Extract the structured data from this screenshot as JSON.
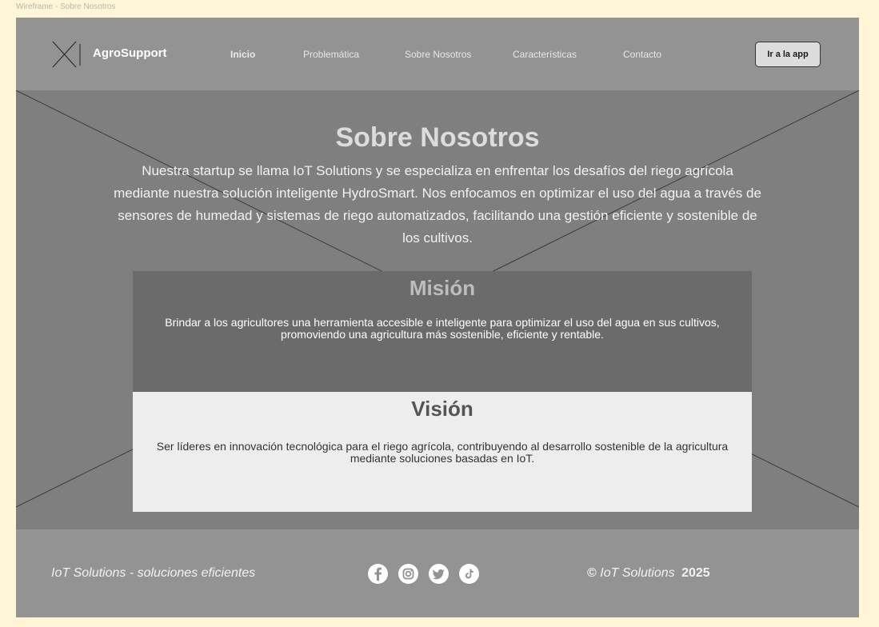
{
  "frame_label": "Wireframe - Sobre Nosotros",
  "header": {
    "brand": "AgroSupport",
    "logo_icon": "x-placeholder-icon",
    "nav": [
      {
        "label": "Inicio",
        "active": true
      },
      {
        "label": "Problemática",
        "active": false
      },
      {
        "label": "Sobre Nosotros",
        "active": false
      },
      {
        "label": "Características",
        "active": false
      },
      {
        "label": "Contacto",
        "active": false
      }
    ],
    "app_button": "Ir a la app"
  },
  "hero": {
    "title": "Sobre Nosotros",
    "text": "Nuestra startup se llama IoT Solutions y se especializa en enfrentar los desafíos del riego agrícola mediante nuestra solución inteligente HydroSmart. Nos enfocamos en optimizar el uso del agua a través de sensores de humedad y sistemas de riego automatizados, facilitando una gestión eficiente y sostenible de los cultivos."
  },
  "mission": {
    "title": "Misión",
    "text": "Brindar a los agricultores una herramienta accesible e inteligente para optimizar el uso del agua en sus cultivos, promoviendo una agricultura más sostenible, eficiente y rentable."
  },
  "vision": {
    "title": "Visión",
    "text": "Ser líderes en innovación tecnológica para el riego agrícola, contribuyendo al desarrollo sostenible de la agricultura mediante soluciones basadas en IoT."
  },
  "footer": {
    "tagline": "IoT Solutions - soluciones eficientes",
    "social": [
      "facebook-icon",
      "instagram-icon",
      "twitter-icon",
      "tiktok-icon"
    ],
    "copyright_symbol": "©",
    "copyright_company": "IoT Solutions",
    "copyright_year": "2025"
  },
  "colors": {
    "page_bg": "#fff6d8",
    "header_bg": "#939393",
    "hero_bg": "#7f7f7f",
    "mission_bg": "#6b6b6b",
    "vision_bg": "#ededed"
  }
}
